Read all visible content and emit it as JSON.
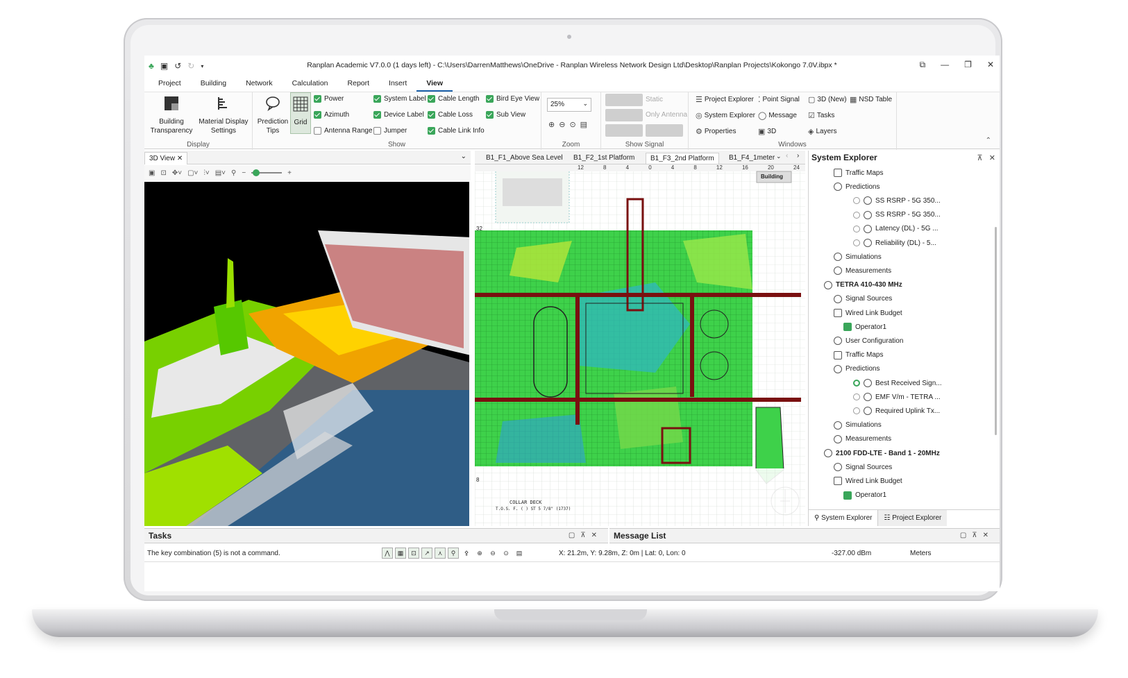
{
  "app": {
    "title": "Ranplan Academic V7.0.0 (1 days left) - C:\\Users\\DarrenMatthews\\OneDrive - Ranplan Wireless Network Design Ltd\\Desktop\\Ranplan Projects\\Kokongo 7.0V.ibpx *"
  },
  "menu": [
    "Project",
    "Building",
    "Network",
    "Calculation",
    "Report",
    "Insert",
    "View"
  ],
  "menu_active": "View",
  "ribbon": {
    "display": {
      "name": "Display",
      "building_transparency": "Building\nTransparency",
      "material_display": "Material Display\nSettings"
    },
    "show": {
      "name": "Show",
      "prediction_tips": "Prediction\nTips",
      "grid": "Grid",
      "checks": [
        {
          "label": "Power",
          "checked": true
        },
        {
          "label": "Azimuth",
          "checked": true
        },
        {
          "label": "Antenna Range",
          "checked": false
        },
        {
          "label": "System Label",
          "checked": true
        },
        {
          "label": "Device Label",
          "checked": true
        },
        {
          "label": "Jumper",
          "checked": false
        },
        {
          "label": "Cable Length",
          "checked": true
        },
        {
          "label": "Cable Loss",
          "checked": true
        },
        {
          "label": "Cable Link Info",
          "checked": true
        },
        {
          "label": "Bird Eye View",
          "checked": true
        },
        {
          "label": "Sub View",
          "checked": true
        }
      ]
    },
    "zoom": {
      "name": "Zoom",
      "value": "25%"
    },
    "show_signal": {
      "name": "Show Signal",
      "static": "Static",
      "only_antenna": "Only Antenna"
    },
    "windows": {
      "name": "Windows",
      "items": [
        "Project Explorer",
        "Point Signal",
        "3D (New)",
        "NSD Table",
        "System Explorer",
        "Message",
        "Tasks",
        "Properties",
        "3D",
        "Layers"
      ]
    }
  },
  "view3d": {
    "tab": "3D View"
  },
  "plan": {
    "tabs": [
      "B1_F1_Above Sea Level",
      "B1_F2_1st Platform",
      "B1_F3_2nd Platform",
      "B1_F4_1meter"
    ],
    "selected": "B1_F3_2nd Platform",
    "ruler": [
      "12",
      "8",
      "4",
      "0",
      "4",
      "8",
      "12",
      "16",
      "20",
      "24"
    ],
    "building_label": "Building",
    "left_ruler": [
      "32",
      "8"
    ],
    "deck_label": "COLLAR DECK",
    "deck_sub": "T.O.S. F. ( ) ST 5 7/8\" (1737)"
  },
  "system_explorer": {
    "title": "System Explorer",
    "tree": [
      {
        "label": "Traffic Maps",
        "indent": 2,
        "icon": "traffic"
      },
      {
        "label": "Predictions",
        "indent": 2,
        "icon": "pred"
      },
      {
        "label": "SS RSRP - 5G 350...",
        "indent": 4,
        "icon": "pred",
        "radio": "off"
      },
      {
        "label": "SS RSRP - 5G 350...",
        "indent": 4,
        "icon": "pred",
        "radio": "off"
      },
      {
        "label": "Latency (DL) - 5G ...",
        "indent": 4,
        "icon": "pred",
        "radio": "off"
      },
      {
        "label": "Reliability (DL) - 5...",
        "indent": 4,
        "icon": "pred",
        "radio": "off"
      },
      {
        "label": "Simulations",
        "indent": 2,
        "icon": "sim"
      },
      {
        "label": "Measurements",
        "indent": 2,
        "icon": "wifi"
      },
      {
        "label": "TETRA 410-430 MHz",
        "indent": 1,
        "icon": "antenna",
        "bold": true
      },
      {
        "label": "Signal Sources",
        "indent": 2,
        "icon": "src"
      },
      {
        "label": "Wired Link Budget",
        "indent": 2,
        "icon": "budget"
      },
      {
        "label": "Operator1",
        "indent": 3,
        "icon": "green"
      },
      {
        "label": "User Configuration",
        "indent": 2,
        "icon": "user"
      },
      {
        "label": "Traffic Maps",
        "indent": 2,
        "icon": "traffic"
      },
      {
        "label": "Predictions",
        "indent": 2,
        "icon": "pred"
      },
      {
        "label": "Best Received Sign...",
        "indent": 4,
        "icon": "pred",
        "radio": "on"
      },
      {
        "label": "EMF V/m - TETRA ...",
        "indent": 4,
        "icon": "pred",
        "radio": "off"
      },
      {
        "label": "Required Uplink Tx...",
        "indent": 4,
        "icon": "pred",
        "radio": "off"
      },
      {
        "label": "Simulations",
        "indent": 2,
        "icon": "sim"
      },
      {
        "label": "Measurements",
        "indent": 2,
        "icon": "wifi"
      },
      {
        "label": "2100 FDD-LTE - Band 1 - 20MHz",
        "indent": 1,
        "icon": "antenna",
        "bold": true
      },
      {
        "label": "Signal Sources",
        "indent": 2,
        "icon": "src"
      },
      {
        "label": "Wired Link Budget",
        "indent": 2,
        "icon": "budget"
      },
      {
        "label": "Operator1",
        "indent": 3,
        "icon": "green"
      }
    ],
    "bottom_tabs": [
      "System Explorer",
      "Project Explorer"
    ]
  },
  "tasks": {
    "title": "Tasks"
  },
  "message_list": {
    "title": "Message List"
  },
  "status": {
    "message": "The key combination (5) is not a command.",
    "coords": "X: 21.2m, Y: 9.28m, Z: 0m | Lat: 0, Lon: 0",
    "signal": "-327.00 dBm",
    "units": "Meters"
  }
}
